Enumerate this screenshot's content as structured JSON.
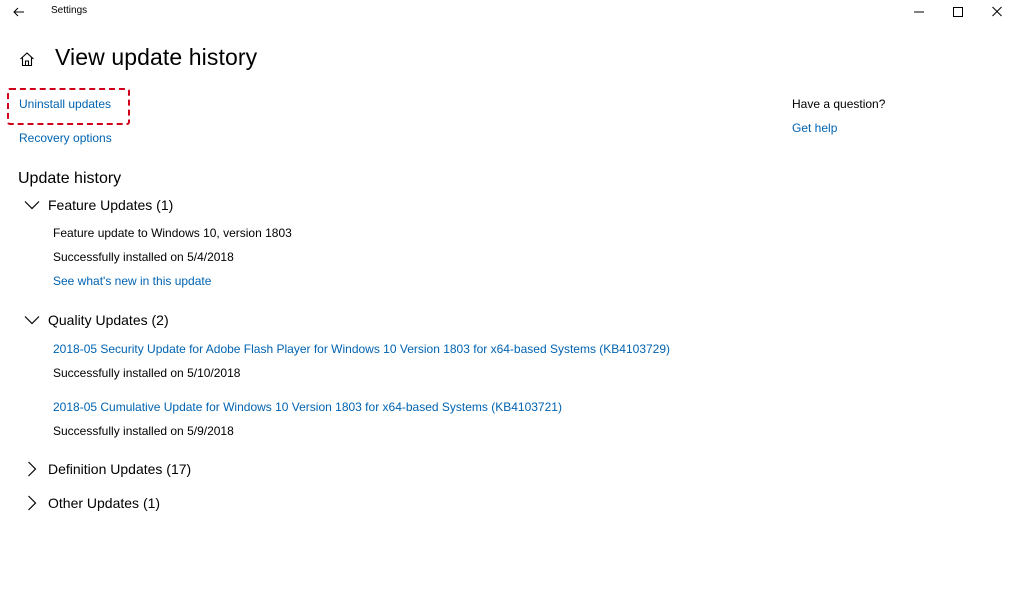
{
  "window": {
    "app_title": "Settings"
  },
  "header": {
    "page_title": "View update history"
  },
  "links": {
    "uninstall_updates": "Uninstall updates",
    "recovery_options": "Recovery options"
  },
  "help": {
    "question": "Have a question?",
    "get_help": "Get help"
  },
  "history": {
    "title": "Update history",
    "groups": [
      {
        "label": "Feature Updates (1)",
        "expanded": true,
        "items": [
          {
            "name": "Feature update to Windows 10, version 1803",
            "status": "Successfully installed on 5/4/2018",
            "link": "See what's new in this update"
          }
        ]
      },
      {
        "label": "Quality Updates (2)",
        "expanded": true,
        "items": [
          {
            "name": "2018-05 Security Update for Adobe Flash Player for Windows 10 Version 1803 for x64-based Systems (KB4103729)",
            "status": "Successfully installed on 5/10/2018"
          },
          {
            "name": "2018-05 Cumulative Update for Windows 10 Version 1803 for x64-based Systems (KB4103721)",
            "status": "Successfully installed on 5/9/2018"
          }
        ]
      },
      {
        "label": "Definition Updates (17)",
        "expanded": false
      },
      {
        "label": "Other Updates (1)",
        "expanded": false
      }
    ]
  },
  "icons": {
    "back": "back-arrow-icon",
    "minimize": "minimize-icon",
    "maximize": "maximize-icon",
    "close": "close-icon",
    "home": "home-icon",
    "expanded": "chevron-down-icon",
    "collapsed": "chevron-right-icon"
  },
  "colors": {
    "link": "#0063b1",
    "highlight": "#d0021b",
    "background": "#ffffff"
  }
}
